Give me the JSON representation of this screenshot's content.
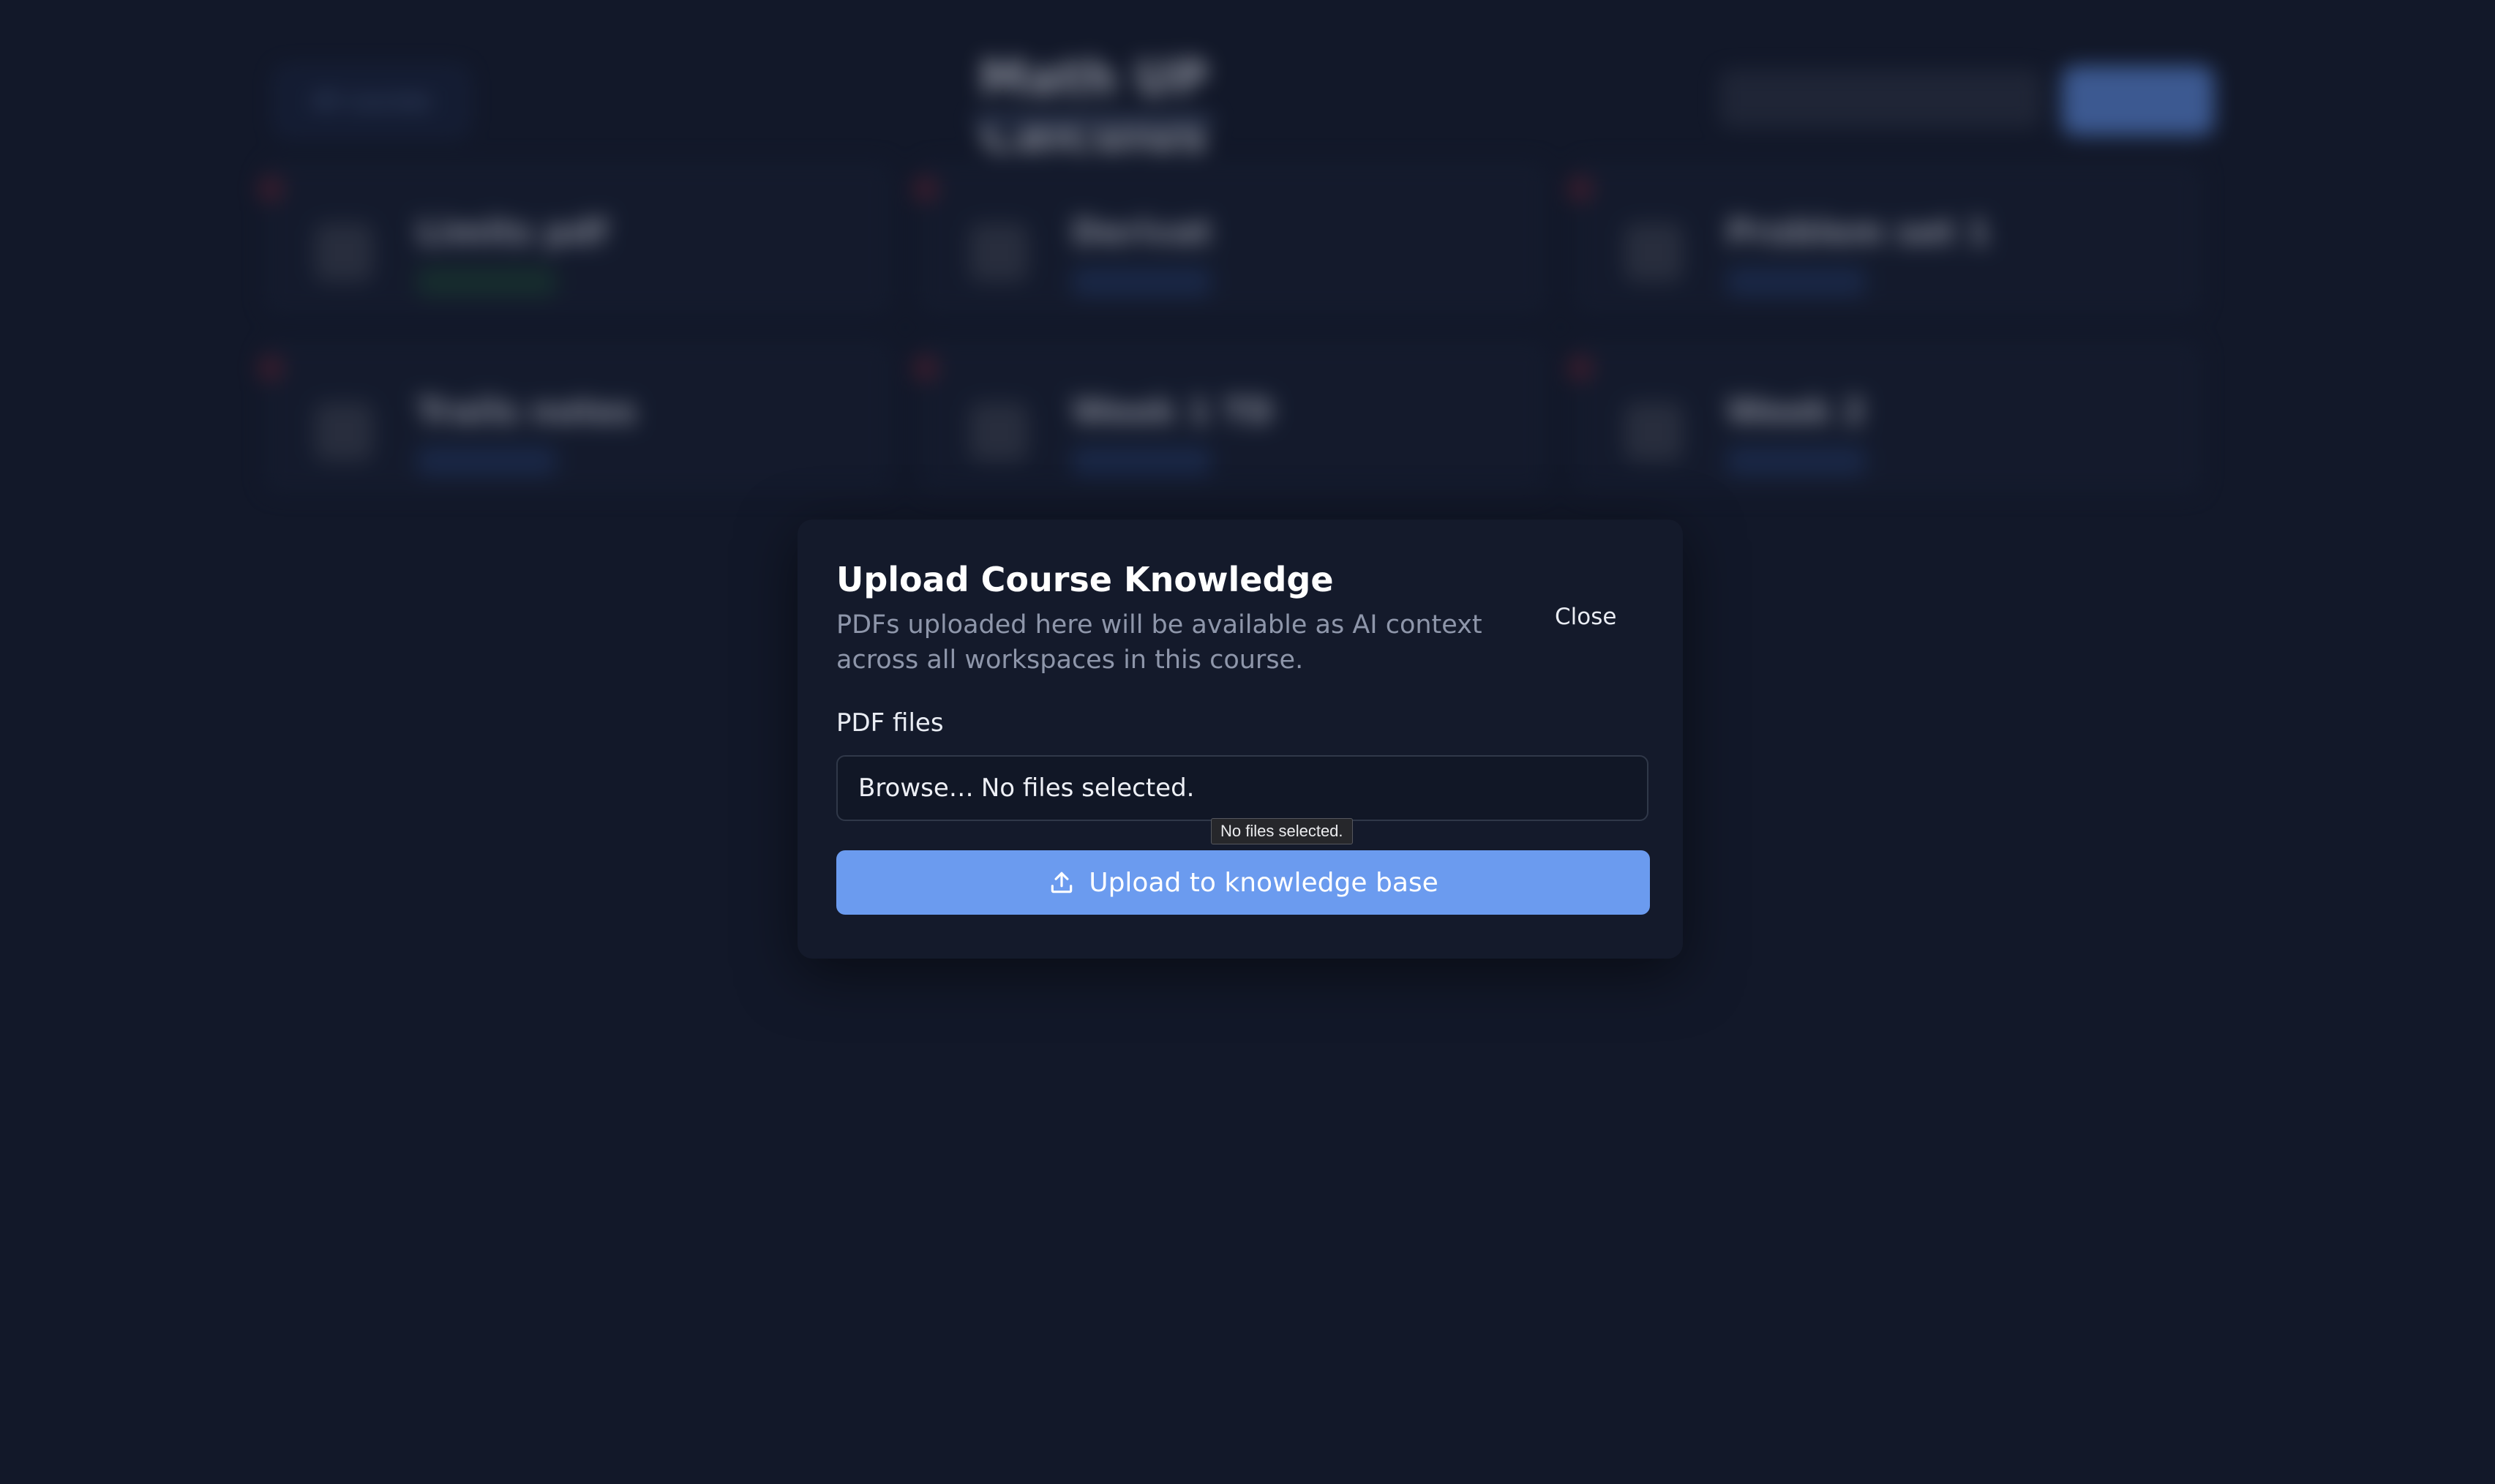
{
  "background": {
    "app_title": "Math UP Calculus",
    "back_button_label": "All courses",
    "cards": [
      {
        "name": "Limits pdf",
        "tag_color": "#1b3f31"
      },
      {
        "name": "Derivat",
        "tag_color": "#20345e"
      },
      {
        "name": "Problem set 1",
        "tag_color": "#20345e"
      },
      {
        "name": "Trails notes",
        "tag_color": "#20345e"
      },
      {
        "name": "Week 1 TD",
        "tag_color": "#20345e"
      },
      {
        "name": "Week 2",
        "tag_color": "#20345e"
      }
    ]
  },
  "dialog": {
    "title": "Upload Course Knowledge",
    "description": "PDFs uploaded here will be available as AI context across all workspaces in this course.",
    "close_label": "Close",
    "field_label": "PDF files",
    "file_input": {
      "browse_label": "Browse…",
      "status": "No files selected."
    },
    "tooltip": "No files selected.",
    "upload_button_label": "Upload to knowledge base",
    "upload_icon": "upload-icon"
  },
  "colors": {
    "page_background": "#121829",
    "dialog_background": "#141a2b",
    "accent": "#6b9bef"
  }
}
